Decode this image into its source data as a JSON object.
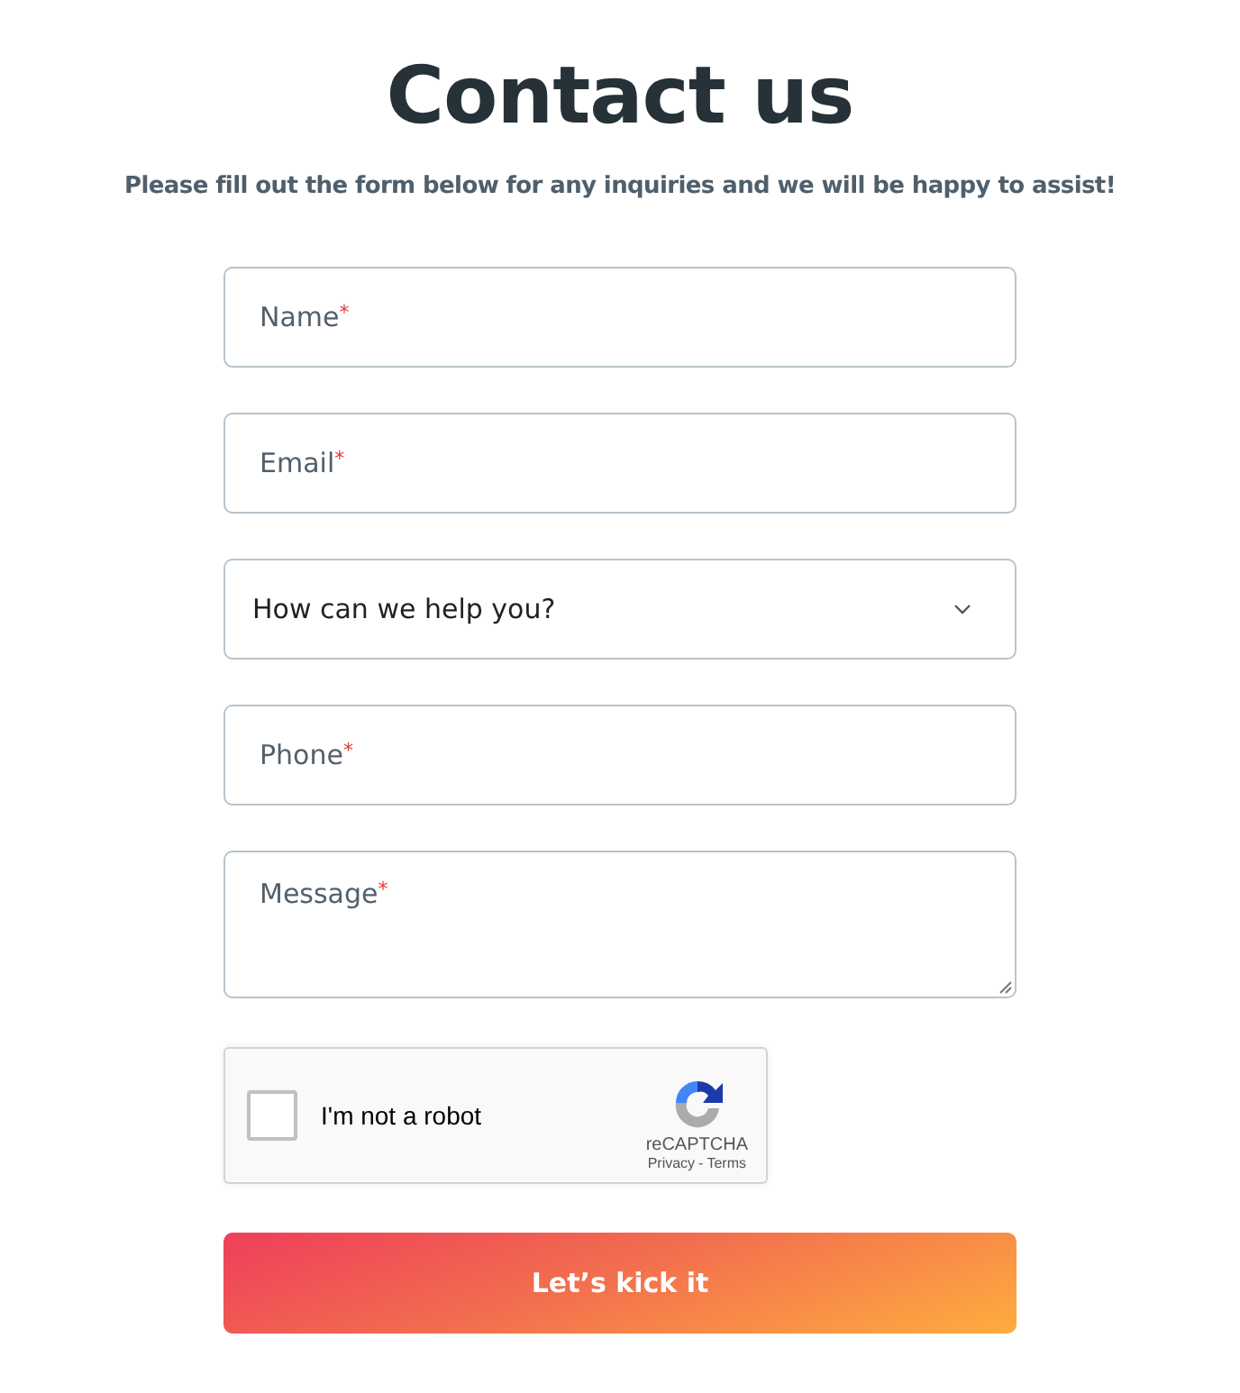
{
  "title": "Contact us",
  "subtitle": "Please fill out the form below for any inquiries and we will be happy to assist!",
  "fields": [
    {
      "kind": "text",
      "placeholder": "Name",
      "required_mark": "*"
    },
    {
      "kind": "text",
      "placeholder": "Email",
      "required_mark": "*"
    },
    {
      "kind": "select",
      "value": "How can we help you?"
    },
    {
      "kind": "text",
      "placeholder": "Phone",
      "required_mark": "*"
    },
    {
      "kind": "textarea",
      "placeholder": "Message",
      "required_mark": "*"
    }
  ],
  "captcha": {
    "label": "I'm not a robot",
    "checked": false,
    "brand": "reCAPTCHA",
    "links": [
      "Privacy",
      "Terms"
    ],
    "separator": "-"
  },
  "submit": "Let’s kick it"
}
